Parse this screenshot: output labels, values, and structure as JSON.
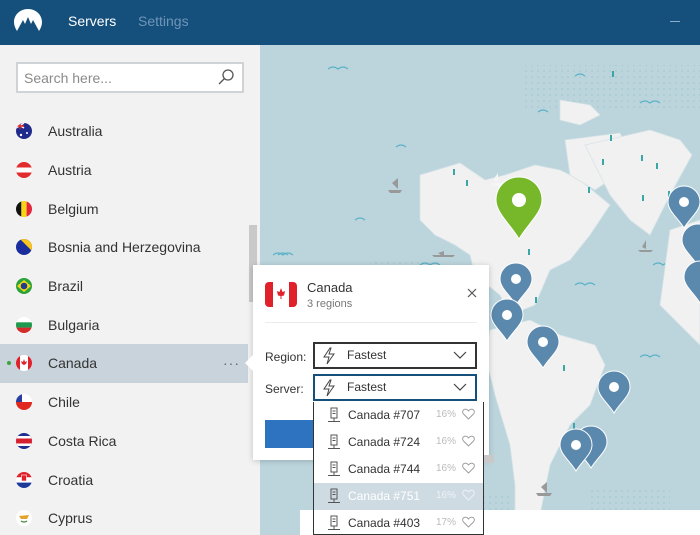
{
  "header": {
    "tabs": [
      {
        "label": "Servers",
        "active": true
      },
      {
        "label": "Settings",
        "active": false
      }
    ]
  },
  "sidebar": {
    "search": {
      "placeholder": "Search here...",
      "value": ""
    },
    "countries": [
      {
        "name": "Australia",
        "flag": "australia"
      },
      {
        "name": "Austria",
        "flag": "austria"
      },
      {
        "name": "Belgium",
        "flag": "belgium"
      },
      {
        "name": "Bosnia and Herzegovina",
        "flag": "bosnia"
      },
      {
        "name": "Brazil",
        "flag": "brazil"
      },
      {
        "name": "Bulgaria",
        "flag": "bulgaria"
      },
      {
        "name": "Canada",
        "flag": "canada",
        "selected": true,
        "connected": true
      },
      {
        "name": "Chile",
        "flag": "chile"
      },
      {
        "name": "Costa Rica",
        "flag": "costa-rica"
      },
      {
        "name": "Croatia",
        "flag": "croatia"
      },
      {
        "name": "Cyprus",
        "flag": "cyprus"
      }
    ],
    "more_label": "···"
  },
  "popup": {
    "country": "Canada",
    "subtitle": "3 regions",
    "region_label": "Region:",
    "region_value": "Fastest",
    "server_label": "Server:",
    "server_value": "Fastest"
  },
  "dropdown": {
    "servers": [
      {
        "name": "Canada #707",
        "load": "16%"
      },
      {
        "name": "Canada #724",
        "load": "16%"
      },
      {
        "name": "Canada #744",
        "load": "16%"
      },
      {
        "name": "Canada #751",
        "load": "16%",
        "hover": true
      },
      {
        "name": "Canada #403",
        "load": "17%"
      }
    ]
  },
  "colors": {
    "header_bg": "#154f7c",
    "accent_blue": "#2e73bf",
    "pin_active": "#77b82a",
    "pin_default": "#5b88ad",
    "map_water": "#bcd5dd",
    "map_land": "#f1f1f1"
  }
}
